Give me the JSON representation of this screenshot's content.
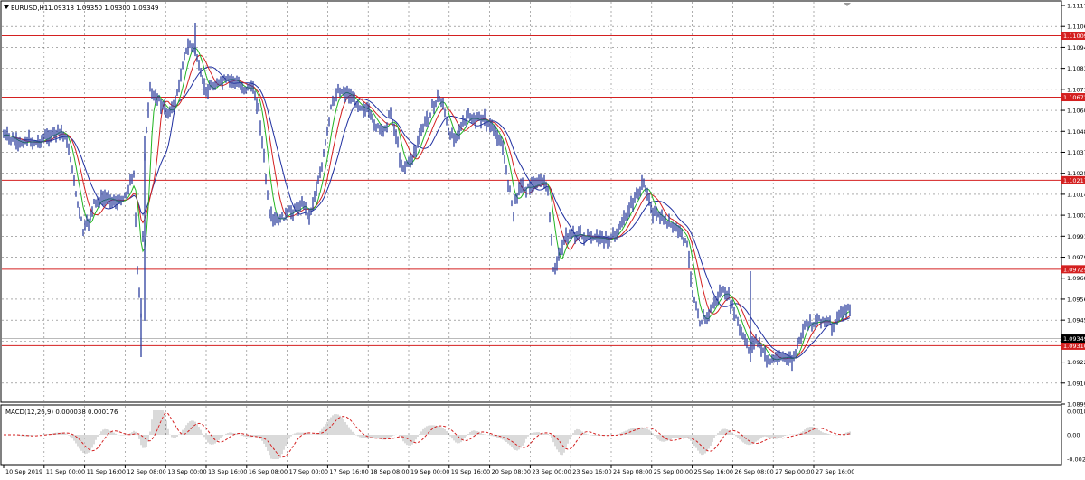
{
  "header": {
    "symbol_label": "EURUSD,H1",
    "ohlc_text": "1.09318 1.09350 1.09300 1.09349"
  },
  "price_scale": {
    "ticks": [
      "1.11175",
      "1.11060",
      "1.10945",
      "1.10830",
      "1.10715",
      "1.10600",
      "1.10485",
      "1.10370",
      "1.10255",
      "1.10140",
      "1.10025",
      "1.09910",
      "1.09795",
      "1.09680",
      "1.09565",
      "1.09450",
      "1.09335",
      "1.09220",
      "1.09105",
      "1.08990"
    ],
    "levels": [
      {
        "value": 1.11009,
        "label": "1.11009"
      },
      {
        "value": 1.10672,
        "label": "1.10672"
      },
      {
        "value": 1.10217,
        "label": "1.10217"
      },
      {
        "value": 1.09729,
        "label": "1.09729"
      },
      {
        "value": 1.0931,
        "label": "1.09310"
      }
    ],
    "current": {
      "value": 1.09349,
      "label": "1.09349"
    }
  },
  "time_axis": {
    "labels": [
      "10 Sep 2019",
      "11 Sep 00:00",
      "11 Sep 16:00",
      "12 Sep 08:00",
      "13 Sep 00:00",
      "13 Sep 16:00",
      "16 Sep 08:00",
      "17 Sep 00:00",
      "17 Sep 16:00",
      "18 Sep 08:00",
      "19 Sep 00:00",
      "19 Sep 16:00",
      "20 Sep 08:00",
      "23 Sep 00:00",
      "23 Sep 16:00",
      "24 Sep 08:00",
      "25 Sep 00:00",
      "25 Sep 16:00",
      "26 Sep 08:00",
      "27 Sep 00:00",
      "27 Sep 16:00"
    ]
  },
  "macd": {
    "label": "MACD(12,26,9) 0.000038 0.000176",
    "ticks": [
      "0.001895",
      "0.00",
      "-0.00206"
    ]
  },
  "colors": {
    "price_line": "#2d3f9e",
    "ma_fast": "#22b422",
    "ma_mid": "#d42020",
    "ma_slow": "#1f2fa0",
    "level_line": "#d42020",
    "current_bg": "#000000",
    "grid": "#7a7a7a",
    "macd_signal": "#d42020",
    "macd_hist": "#b4b4b4"
  }
}
